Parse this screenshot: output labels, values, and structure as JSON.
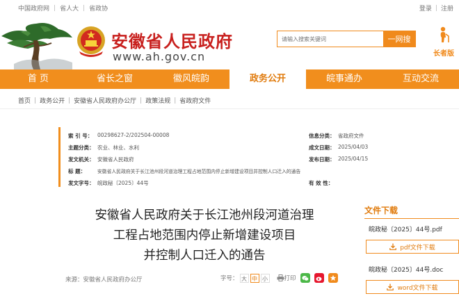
{
  "topbar": {
    "links": [
      "中国政府网",
      "省人大",
      "省政协"
    ],
    "login": "登录",
    "register": "注册"
  },
  "header": {
    "title": "安徽省人民政府",
    "url": "www.ah.gov.cn",
    "search_placeholder": "请输入搜索关键词",
    "search_button": "一网搜",
    "elder_label": "长者版"
  },
  "nav": {
    "items": [
      "首 页",
      "省长之窗",
      "徽风皖韵",
      "政务公开",
      "皖事通办",
      "互动交流"
    ],
    "active_index": 3
  },
  "breadcrumb": [
    "首页",
    "政务公开",
    "安徽省人民政府办公厅",
    "政策法规",
    "省政府文件"
  ],
  "meta": {
    "index_label": "索 引 号：",
    "index_value": "00298627-2/202504-00008",
    "info_cat_label": "信息分类：",
    "info_cat_value": "省政府文件",
    "topic_label": "主题分类：",
    "topic_value": "农业、林业、水利",
    "date_label": "成文日期：",
    "date_value": "2025/04/03",
    "issuer_label": "发文机关：",
    "issuer_value": "安徽省人民政府",
    "pub_label": "发布日期：",
    "pub_value": "2025/04/15",
    "title_label": "标      题：",
    "title_value": "安徽省人民政府关于长江池州段河道治理工程占地范围内停止新增建设项目并控制人口迁入的通告",
    "docno_label": "发文字号：",
    "docno_value": "皖政秘〔2025〕44号",
    "valid_label": "有 效 性："
  },
  "article": {
    "title_lines": [
      "安徽省人民政府关于长江池州段河道治理",
      "工程占地范围内停止新增建设项目",
      "并控制人口迁入的通告"
    ],
    "source": "来源：安徽省人民政府办公厅",
    "font_label": "字号：",
    "sizes": [
      "大",
      "中",
      "小"
    ],
    "print_label": "打印"
  },
  "downloads": {
    "heading": "文件下载",
    "files": [
      {
        "name": "皖政秘〔2025〕44号.pdf",
        "button": "pdf文件下载"
      },
      {
        "name": "皖政秘〔2025〕44号.doc",
        "button": "word文件下载"
      }
    ]
  },
  "colors": {
    "accent": "#f18e1d",
    "title_red": "#c8201e"
  }
}
